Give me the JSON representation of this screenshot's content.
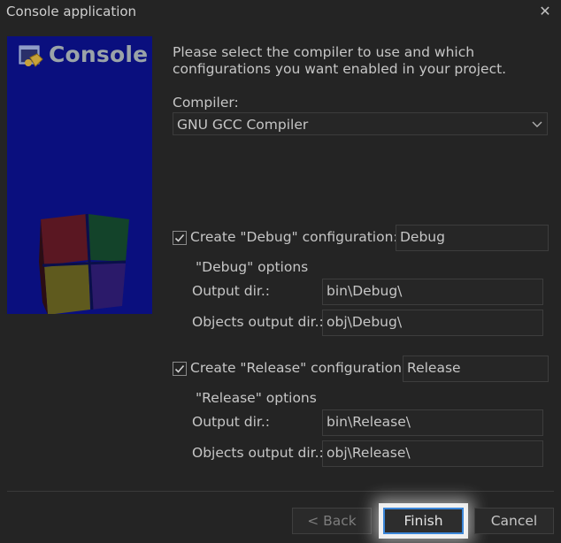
{
  "window": {
    "title": "Console application",
    "close_glyph": "✕"
  },
  "banner": {
    "title": "Console",
    "icon": "console-app-logo"
  },
  "intro_text": "Please select the compiler to use and which configurations you want enabled in your project.",
  "compiler": {
    "label": "Compiler:",
    "selected": "GNU GCC Compiler"
  },
  "debug": {
    "checked": true,
    "checkbox_label": "Create \"Debug\" configuration:",
    "name": "Debug",
    "group_title": "\"Debug\" options",
    "output_label": "Output dir.:",
    "output_value": "bin\\Debug\\",
    "objects_label": "Objects output dir.:",
    "objects_value": "obj\\Debug\\"
  },
  "release": {
    "checked": true,
    "checkbox_label": "Create \"Release\" configuration:",
    "name": "Release",
    "group_title": "\"Release\" options",
    "output_label": "Output dir.:",
    "output_value": "bin\\Release\\",
    "objects_label": "Objects output dir.:",
    "objects_value": "obj\\Release\\"
  },
  "buttons": {
    "back": "< Back",
    "finish": "Finish",
    "cancel": "Cancel"
  },
  "colors": {
    "banner_bg": "#0a0f7e",
    "focus_ring": "#3b86d8",
    "window_bg": "#242424"
  }
}
